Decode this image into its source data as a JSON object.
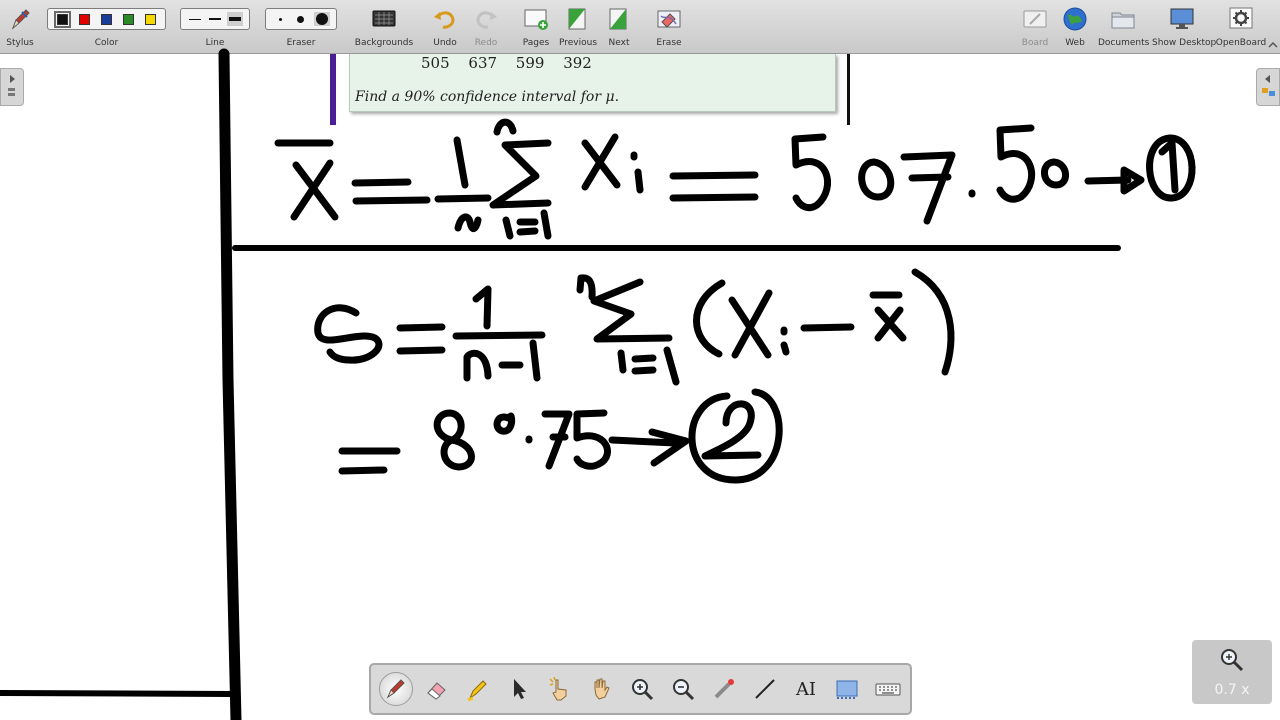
{
  "toolbar": {
    "stylus": "Stylus",
    "color": "Color",
    "line": "Line",
    "eraser": "Eraser",
    "backgrounds": "Backgrounds",
    "undo": "Undo",
    "redo": "Redo",
    "pages": "Pages",
    "previous": "Previous",
    "next": "Next",
    "erase": "Erase",
    "board": "Board",
    "web": "Web",
    "documents": "Documents",
    "show_desktop": "Show Desktop",
    "openboard": "OpenBoard",
    "colors": [
      "#111111",
      "#e00000",
      "#1a3d9a",
      "#2a8a2a",
      "#f5d800"
    ]
  },
  "document": {
    "numbers": "505 637 599 392",
    "question": "Find a 90% confidence interval for μ."
  },
  "zoom": {
    "level": "0.7 x"
  }
}
